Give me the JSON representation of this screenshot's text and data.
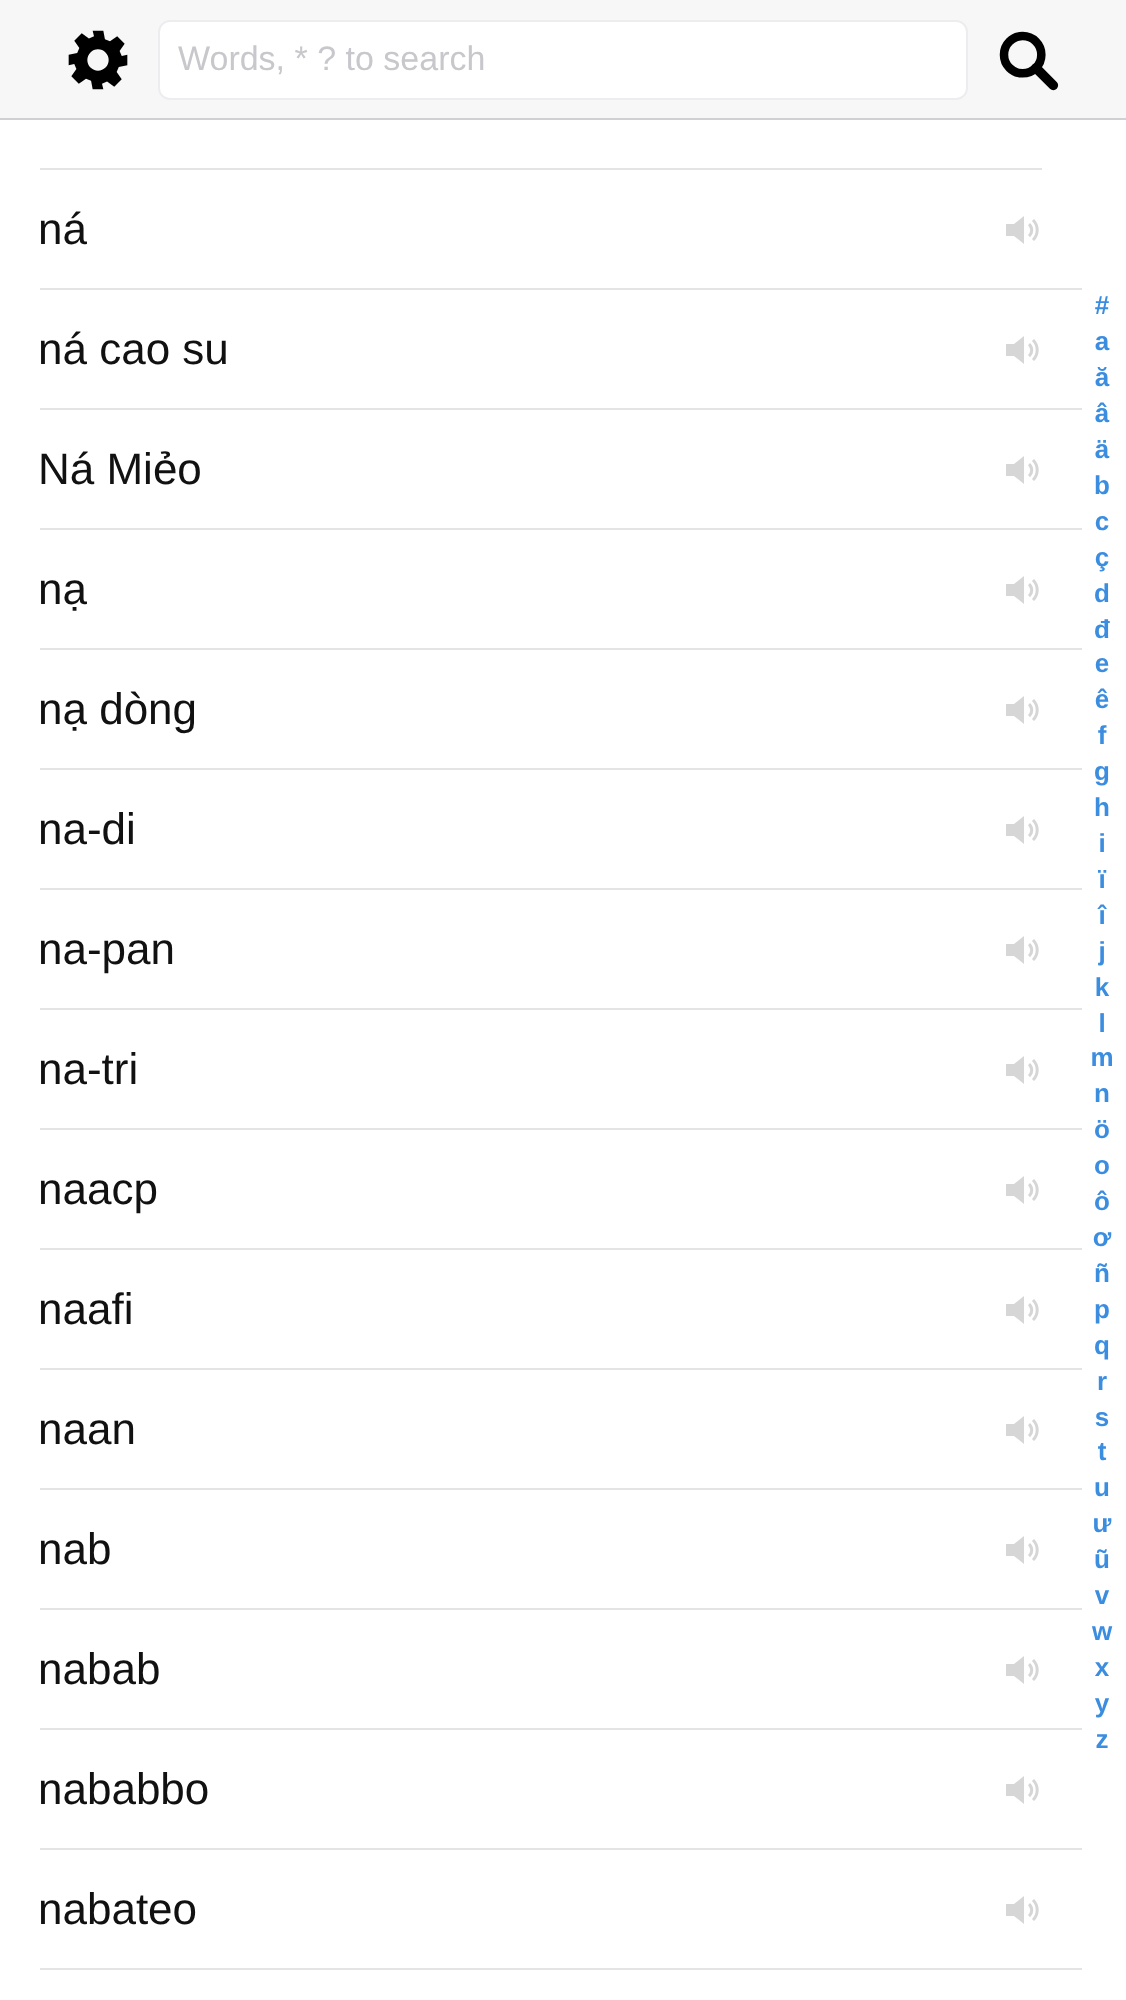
{
  "search": {
    "placeholder": "Words, * ? to search"
  },
  "words": [
    "ná",
    "ná cao su",
    "Ná Miẻo",
    "nạ",
    "nạ dòng",
    "na-di",
    "na-pan",
    "na-tri",
    "naacp",
    "naafi",
    "naan",
    "nab",
    "nabab",
    "nababbo",
    "nabateo"
  ],
  "index": [
    "#",
    "a",
    "ă",
    "â",
    "ä",
    "b",
    "c",
    "ç",
    "d",
    "đ",
    "e",
    "ê",
    "f",
    "g",
    "h",
    "i",
    "ï",
    "î",
    "j",
    "k",
    "l",
    "m",
    "n",
    "ö",
    "o",
    "ô",
    "ơ",
    "ñ",
    "p",
    "q",
    "r",
    "s",
    "t",
    "u",
    "ư",
    "ũ",
    "v",
    "w",
    "x",
    "y",
    "z"
  ]
}
